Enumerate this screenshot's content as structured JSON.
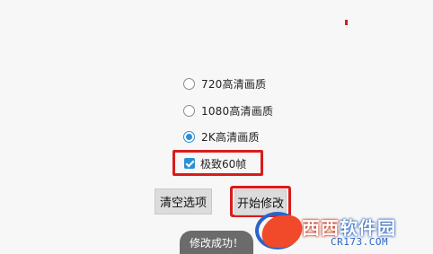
{
  "options": {
    "radios": [
      {
        "label": "720高清画质",
        "checked": false
      },
      {
        "label": "1080高清画质",
        "checked": false
      },
      {
        "label": "2K高清画质",
        "checked": true
      }
    ],
    "extreme_60fps": {
      "label": "极致60帧",
      "checked": true
    }
  },
  "buttons": {
    "clear_label": "清空选项",
    "start_label": "开始修改"
  },
  "toast": {
    "text": "修改成功！"
  },
  "watermark": {
    "title_part1": "西西",
    "title_part2": "软件园",
    "url": "CR173.COM"
  },
  "colors": {
    "accent": "#2a8fd6",
    "highlight": "#d81c1c"
  }
}
